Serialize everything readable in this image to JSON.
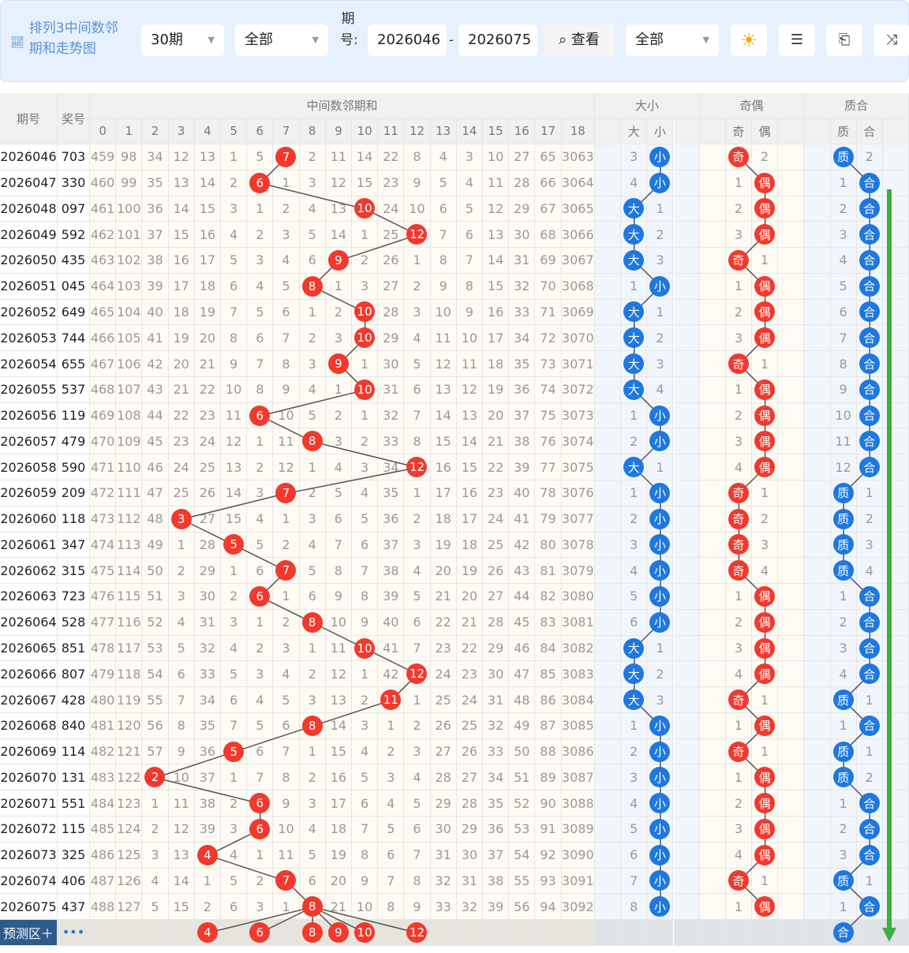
{
  "toolbar": {
    "title_line1": "排列3中间数邻",
    "title_line2": "期和走势图",
    "period_select": "30期",
    "filter_select": "全部",
    "period_label": "期号:",
    "from": "2026046",
    "to": "2026075",
    "query_button": "查看",
    "filter2_select": "全部",
    "icons": [
      "sun-icon",
      "list-icon",
      "exit-icon",
      "shuffle-icon"
    ]
  },
  "header": {
    "period": "期号",
    "prize": "奖号",
    "group_main": "中间数邻期和",
    "group_bs": "大小",
    "group_oe": "奇偶",
    "group_pc": "质合",
    "cols": [
      "0",
      "1",
      "2",
      "3",
      "4",
      "5",
      "6",
      "7",
      "8",
      "9",
      "10",
      "11",
      "12",
      "13",
      "14",
      "15",
      "16",
      "17",
      "18"
    ],
    "bs": [
      "大",
      "小"
    ],
    "oe": [
      "奇",
      "偶"
    ],
    "pc": [
      "质",
      "合"
    ]
  },
  "colors": {
    "hit_red": "#f3382e",
    "hit_blue": "#1f78e1",
    "arrow_green": "#3cb043"
  },
  "rows": [
    {
      "p": "2026046",
      "n": "703",
      "v": [
        "459",
        "98",
        "34",
        "12",
        "13",
        "1",
        "5",
        "7",
        "2",
        "11",
        "14",
        "22",
        "8",
        "4",
        "3",
        "10",
        "27",
        "65",
        "3063"
      ],
      "h": 7,
      "bs": [
        "3",
        "小"
      ],
      "oe": [
        "奇",
        "2"
      ],
      "pc": [
        "质",
        "2"
      ]
    },
    {
      "p": "2026047",
      "n": "330",
      "v": [
        "460",
        "99",
        "35",
        "13",
        "14",
        "2",
        "6",
        "1",
        "3",
        "12",
        "15",
        "23",
        "9",
        "5",
        "4",
        "11",
        "28",
        "66",
        "3064"
      ],
      "h": 6,
      "bs": [
        "4",
        "小"
      ],
      "oe": [
        "1",
        "偶"
      ],
      "pc": [
        "1",
        "合"
      ]
    },
    {
      "p": "2026048",
      "n": "097",
      "v": [
        "461",
        "100",
        "36",
        "14",
        "15",
        "3",
        "1",
        "2",
        "4",
        "13",
        "10",
        "24",
        "10",
        "6",
        "5",
        "12",
        "29",
        "67",
        "3065"
      ],
      "h": 10,
      "bs": [
        "大",
        "1"
      ],
      "oe": [
        "2",
        "偶"
      ],
      "pc": [
        "2",
        "合"
      ]
    },
    {
      "p": "2026049",
      "n": "592",
      "v": [
        "462",
        "101",
        "37",
        "15",
        "16",
        "4",
        "2",
        "3",
        "5",
        "14",
        "1",
        "25",
        "12",
        "7",
        "6",
        "13",
        "30",
        "68",
        "3066"
      ],
      "h": 12,
      "bs": [
        "大",
        "2"
      ],
      "oe": [
        "3",
        "偶"
      ],
      "pc": [
        "3",
        "合"
      ]
    },
    {
      "p": "2026050",
      "n": "435",
      "v": [
        "463",
        "102",
        "38",
        "16",
        "17",
        "5",
        "3",
        "4",
        "6",
        "9",
        "2",
        "26",
        "1",
        "8",
        "7",
        "14",
        "31",
        "69",
        "3067"
      ],
      "h": 9,
      "bs": [
        "大",
        "3"
      ],
      "oe": [
        "奇",
        "1"
      ],
      "pc": [
        "4",
        "合"
      ]
    },
    {
      "p": "2026051",
      "n": "045",
      "v": [
        "464",
        "103",
        "39",
        "17",
        "18",
        "6",
        "4",
        "5",
        "8",
        "1",
        "3",
        "27",
        "2",
        "9",
        "8",
        "15",
        "32",
        "70",
        "3068"
      ],
      "h": 8,
      "bs": [
        "1",
        "小"
      ],
      "oe": [
        "1",
        "偶"
      ],
      "pc": [
        "5",
        "合"
      ]
    },
    {
      "p": "2026052",
      "n": "649",
      "v": [
        "465",
        "104",
        "40",
        "18",
        "19",
        "7",
        "5",
        "6",
        "1",
        "2",
        "10",
        "28",
        "3",
        "10",
        "9",
        "16",
        "33",
        "71",
        "3069"
      ],
      "h": 10,
      "bs": [
        "大",
        "1"
      ],
      "oe": [
        "2",
        "偶"
      ],
      "pc": [
        "6",
        "合"
      ]
    },
    {
      "p": "2026053",
      "n": "744",
      "v": [
        "466",
        "105",
        "41",
        "19",
        "20",
        "8",
        "6",
        "7",
        "2",
        "3",
        "10",
        "29",
        "4",
        "11",
        "10",
        "17",
        "34",
        "72",
        "3070"
      ],
      "h": 10,
      "bs": [
        "大",
        "2"
      ],
      "oe": [
        "3",
        "偶"
      ],
      "pc": [
        "7",
        "合"
      ]
    },
    {
      "p": "2026054",
      "n": "655",
      "v": [
        "467",
        "106",
        "42",
        "20",
        "21",
        "9",
        "7",
        "8",
        "3",
        "9",
        "1",
        "30",
        "5",
        "12",
        "11",
        "18",
        "35",
        "73",
        "3071"
      ],
      "h": 9,
      "bs": [
        "大",
        "3"
      ],
      "oe": [
        "奇",
        "1"
      ],
      "pc": [
        "8",
        "合"
      ]
    },
    {
      "p": "2026055",
      "n": "537",
      "v": [
        "468",
        "107",
        "43",
        "21",
        "22",
        "10",
        "8",
        "9",
        "4",
        "1",
        "10",
        "31",
        "6",
        "13",
        "12",
        "19",
        "36",
        "74",
        "3072"
      ],
      "h": 10,
      "bs": [
        "大",
        "4"
      ],
      "oe": [
        "1",
        "偶"
      ],
      "pc": [
        "9",
        "合"
      ]
    },
    {
      "p": "2026056",
      "n": "119",
      "v": [
        "469",
        "108",
        "44",
        "22",
        "23",
        "11",
        "6",
        "10",
        "5",
        "2",
        "1",
        "32",
        "7",
        "14",
        "13",
        "20",
        "37",
        "75",
        "3073"
      ],
      "h": 6,
      "bs": [
        "1",
        "小"
      ],
      "oe": [
        "2",
        "偶"
      ],
      "pc": [
        "10",
        "合"
      ]
    },
    {
      "p": "2026057",
      "n": "479",
      "v": [
        "470",
        "109",
        "45",
        "23",
        "24",
        "12",
        "1",
        "11",
        "8",
        "3",
        "2",
        "33",
        "8",
        "15",
        "14",
        "21",
        "38",
        "76",
        "3074"
      ],
      "h": 8,
      "bs": [
        "2",
        "小"
      ],
      "oe": [
        "3",
        "偶"
      ],
      "pc": [
        "11",
        "合"
      ]
    },
    {
      "p": "2026058",
      "n": "590",
      "v": [
        "471",
        "110",
        "46",
        "24",
        "25",
        "13",
        "2",
        "12",
        "1",
        "4",
        "3",
        "34",
        "12",
        "16",
        "15",
        "22",
        "39",
        "77",
        "3075"
      ],
      "h": 12,
      "bs": [
        "大",
        "1"
      ],
      "oe": [
        "4",
        "偶"
      ],
      "pc": [
        "12",
        "合"
      ]
    },
    {
      "p": "2026059",
      "n": "209",
      "v": [
        "472",
        "111",
        "47",
        "25",
        "26",
        "14",
        "3",
        "7",
        "2",
        "5",
        "4",
        "35",
        "1",
        "17",
        "16",
        "23",
        "40",
        "78",
        "3076"
      ],
      "h": 7,
      "bs": [
        "1",
        "小"
      ],
      "oe": [
        "奇",
        "1"
      ],
      "pc": [
        "质",
        "1"
      ]
    },
    {
      "p": "2026060",
      "n": "118",
      "v": [
        "473",
        "112",
        "48",
        "3",
        "27",
        "15",
        "4",
        "1",
        "3",
        "6",
        "5",
        "36",
        "2",
        "18",
        "17",
        "24",
        "41",
        "79",
        "3077"
      ],
      "h": 3,
      "bs": [
        "2",
        "小"
      ],
      "oe": [
        "奇",
        "2"
      ],
      "pc": [
        "质",
        "2"
      ]
    },
    {
      "p": "2026061",
      "n": "347",
      "v": [
        "474",
        "113",
        "49",
        "1",
        "28",
        "5",
        "5",
        "2",
        "4",
        "7",
        "6",
        "37",
        "3",
        "19",
        "18",
        "25",
        "42",
        "80",
        "3078"
      ],
      "h": 5,
      "bs": [
        "3",
        "小"
      ],
      "oe": [
        "奇",
        "3"
      ],
      "pc": [
        "质",
        "3"
      ]
    },
    {
      "p": "2026062",
      "n": "315",
      "v": [
        "475",
        "114",
        "50",
        "2",
        "29",
        "1",
        "6",
        "7",
        "5",
        "8",
        "7",
        "38",
        "4",
        "20",
        "19",
        "26",
        "43",
        "81",
        "3079"
      ],
      "h": 7,
      "bs": [
        "4",
        "小"
      ],
      "oe": [
        "奇",
        "4"
      ],
      "pc": [
        "质",
        "4"
      ]
    },
    {
      "p": "2026063",
      "n": "723",
      "v": [
        "476",
        "115",
        "51",
        "3",
        "30",
        "2",
        "6",
        "1",
        "6",
        "9",
        "8",
        "39",
        "5",
        "21",
        "20",
        "27",
        "44",
        "82",
        "3080"
      ],
      "h": 6,
      "bs": [
        "5",
        "小"
      ],
      "oe": [
        "1",
        "偶"
      ],
      "pc": [
        "1",
        "合"
      ]
    },
    {
      "p": "2026064",
      "n": "528",
      "v": [
        "477",
        "116",
        "52",
        "4",
        "31",
        "3",
        "1",
        "2",
        "8",
        "10",
        "9",
        "40",
        "6",
        "22",
        "21",
        "28",
        "45",
        "83",
        "3081"
      ],
      "h": 8,
      "bs": [
        "6",
        "小"
      ],
      "oe": [
        "2",
        "偶"
      ],
      "pc": [
        "2",
        "合"
      ]
    },
    {
      "p": "2026065",
      "n": "851",
      "v": [
        "478",
        "117",
        "53",
        "5",
        "32",
        "4",
        "2",
        "3",
        "1",
        "11",
        "10",
        "41",
        "7",
        "23",
        "22",
        "29",
        "46",
        "84",
        "3082"
      ],
      "h": 10,
      "bs": [
        "大",
        "1"
      ],
      "oe": [
        "3",
        "偶"
      ],
      "pc": [
        "3",
        "合"
      ]
    },
    {
      "p": "2026066",
      "n": "807",
      "v": [
        "479",
        "118",
        "54",
        "6",
        "33",
        "5",
        "3",
        "4",
        "2",
        "12",
        "1",
        "42",
        "12",
        "24",
        "23",
        "30",
        "47",
        "85",
        "3083"
      ],
      "h": 12,
      "bs": [
        "大",
        "2"
      ],
      "oe": [
        "4",
        "偶"
      ],
      "pc": [
        "4",
        "合"
      ]
    },
    {
      "p": "2026067",
      "n": "428",
      "v": [
        "480",
        "119",
        "55",
        "7",
        "34",
        "6",
        "4",
        "5",
        "3",
        "13",
        "2",
        "11",
        "1",
        "25",
        "24",
        "31",
        "48",
        "86",
        "3084"
      ],
      "h": 11,
      "bs": [
        "大",
        "3"
      ],
      "oe": [
        "奇",
        "1"
      ],
      "pc": [
        "质",
        "1"
      ]
    },
    {
      "p": "2026068",
      "n": "840",
      "v": [
        "481",
        "120",
        "56",
        "8",
        "35",
        "7",
        "5",
        "6",
        "8",
        "14",
        "3",
        "1",
        "2",
        "26",
        "25",
        "32",
        "49",
        "87",
        "3085"
      ],
      "h": 8,
      "bs": [
        "1",
        "小"
      ],
      "oe": [
        "1",
        "偶"
      ],
      "pc": [
        "1",
        "合"
      ]
    },
    {
      "p": "2026069",
      "n": "114",
      "v": [
        "482",
        "121",
        "57",
        "9",
        "36",
        "5",
        "6",
        "7",
        "1",
        "15",
        "4",
        "2",
        "3",
        "27",
        "26",
        "33",
        "50",
        "88",
        "3086"
      ],
      "h": 5,
      "bs": [
        "2",
        "小"
      ],
      "oe": [
        "奇",
        "1"
      ],
      "pc": [
        "质",
        "1"
      ]
    },
    {
      "p": "2026070",
      "n": "131",
      "v": [
        "483",
        "122",
        "2",
        "10",
        "37",
        "1",
        "7",
        "8",
        "2",
        "16",
        "5",
        "3",
        "4",
        "28",
        "27",
        "34",
        "51",
        "89",
        "3087"
      ],
      "h": 2,
      "bs": [
        "3",
        "小"
      ],
      "oe": [
        "1",
        "偶"
      ],
      "pc": [
        "质",
        "2"
      ]
    },
    {
      "p": "2026071",
      "n": "551",
      "v": [
        "484",
        "123",
        "1",
        "11",
        "38",
        "2",
        "6",
        "9",
        "3",
        "17",
        "6",
        "4",
        "5",
        "29",
        "28",
        "35",
        "52",
        "90",
        "3088"
      ],
      "h": 6,
      "bs": [
        "4",
        "小"
      ],
      "oe": [
        "2",
        "偶"
      ],
      "pc": [
        "1",
        "合"
      ]
    },
    {
      "p": "2026072",
      "n": "115",
      "v": [
        "485",
        "124",
        "2",
        "12",
        "39",
        "3",
        "6",
        "10",
        "4",
        "18",
        "7",
        "5",
        "6",
        "30",
        "29",
        "36",
        "53",
        "91",
        "3089"
      ],
      "h": 6,
      "bs": [
        "5",
        "小"
      ],
      "oe": [
        "3",
        "偶"
      ],
      "pc": [
        "2",
        "合"
      ]
    },
    {
      "p": "2026073",
      "n": "325",
      "v": [
        "486",
        "125",
        "3",
        "13",
        "4",
        "4",
        "1",
        "11",
        "5",
        "19",
        "8",
        "6",
        "7",
        "31",
        "30",
        "37",
        "54",
        "92",
        "3090"
      ],
      "h": 4,
      "bs": [
        "6",
        "小"
      ],
      "oe": [
        "4",
        "偶"
      ],
      "pc": [
        "3",
        "合"
      ]
    },
    {
      "p": "2026074",
      "n": "406",
      "v": [
        "487",
        "126",
        "4",
        "14",
        "1",
        "5",
        "2",
        "7",
        "6",
        "20",
        "9",
        "7",
        "8",
        "32",
        "31",
        "38",
        "55",
        "93",
        "3091"
      ],
      "h": 7,
      "bs": [
        "7",
        "小"
      ],
      "oe": [
        "奇",
        "1"
      ],
      "pc": [
        "质",
        "1"
      ]
    },
    {
      "p": "2026075",
      "n": "437",
      "v": [
        "488",
        "127",
        "5",
        "15",
        "2",
        "6",
        "3",
        "1",
        "8",
        "21",
        "10",
        "8",
        "9",
        "33",
        "32",
        "39",
        "56",
        "94",
        "3092"
      ],
      "h": 8,
      "bs": [
        "8",
        "小"
      ],
      "oe": [
        "1",
        "偶"
      ],
      "pc": [
        "1",
        "合"
      ]
    }
  ],
  "predict": {
    "label": "预测区＋",
    "more": "•••",
    "balls": [
      4,
      6,
      8,
      9,
      10,
      12
    ],
    "pc": "合"
  }
}
